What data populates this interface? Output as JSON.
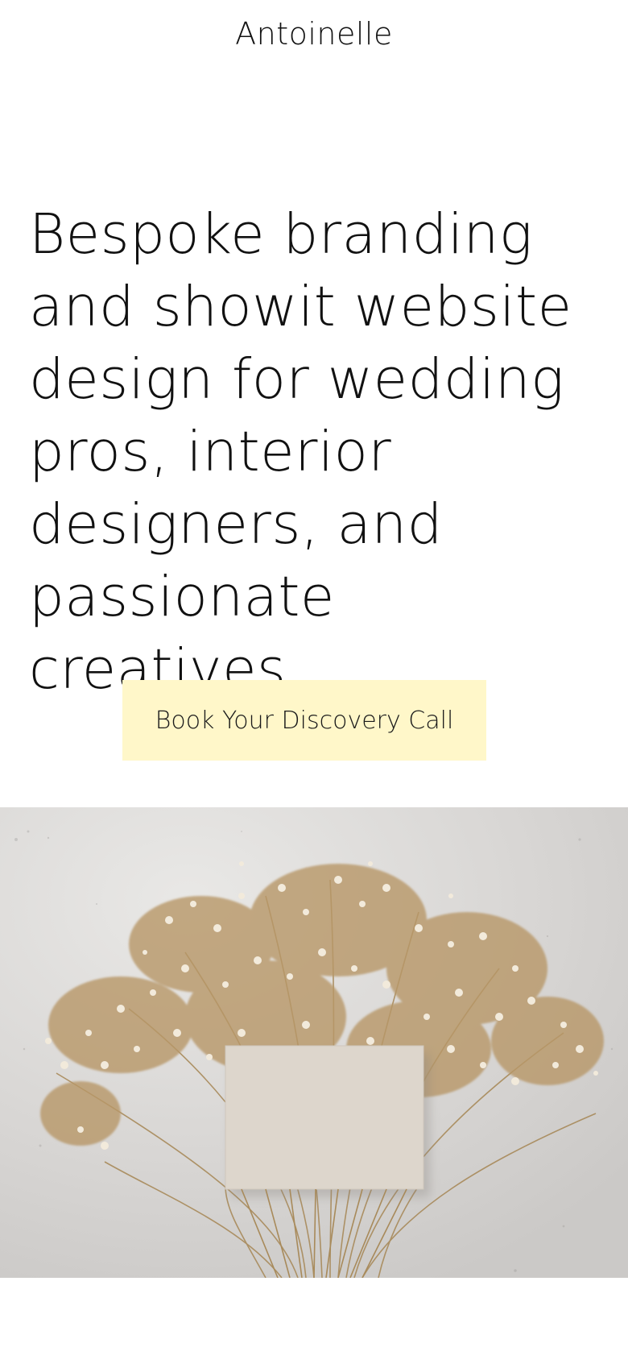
{
  "header": {
    "brand": "Antoinelle"
  },
  "hero": {
    "headline": "Bespoke branding and showit website design for wedding pros, interior designers, and passionate creatives",
    "cta_label": "Book Your Discovery Call"
  },
  "photo": {
    "subject": "flatlay-photo",
    "colors": {
      "background": "#d9d7d5",
      "stems": "#a88a5a",
      "blossoms": "#efe6d6",
      "card": "#ddd6cc"
    }
  },
  "theme": {
    "cta_background": "#fff7c9",
    "text": "#111111"
  }
}
